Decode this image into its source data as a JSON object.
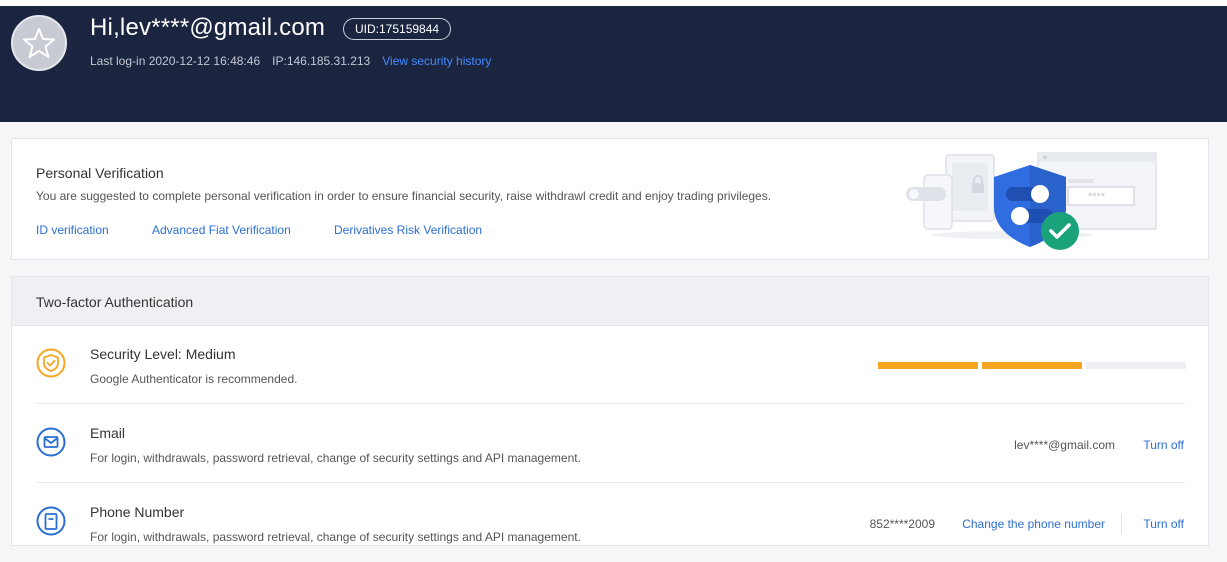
{
  "header": {
    "greeting": "Hi,lev****@gmail.com",
    "uid": "UID:175159844",
    "last_login": "Last log-in 2020-12-12 16:48:46",
    "ip": "IP:146.185.31.213",
    "security_history_link": "View security history",
    "avatar_icon": "star-icon"
  },
  "personal_verification": {
    "title": "Personal Verification",
    "description": "You are suggested to complete personal verification in order to ensure financial security, raise withdrawl credit and enjoy trading privileges.",
    "links": [
      "ID verification",
      "Advanced Fiat Verification",
      "Derivatives Risk Verification"
    ],
    "illustration_icon": "security-shield-illustration",
    "illustration_text": "****"
  },
  "two_factor": {
    "title": "Two-factor Authentication",
    "security_level": {
      "title": "Security Level: Medium",
      "description": "Google Authenticator is recommended.",
      "icon": "shield-icon",
      "segments_filled": 2,
      "segments_total": 3,
      "color": "#f5a623"
    },
    "email": {
      "title": "Email",
      "description": "For login, withdrawals, password retrieval, change of security settings and API management.",
      "value": "lev****@gmail.com",
      "action": "Turn off",
      "icon": "mail-icon"
    },
    "phone": {
      "title": "Phone Number",
      "description": "For login, withdrawals, password retrieval, change of security settings and API management.",
      "value": "852****2009",
      "change_action": "Change the phone number",
      "action": "Turn off",
      "icon": "phone-icon"
    }
  },
  "colors": {
    "header_bg": "#1b2540",
    "link": "#2d6fd1",
    "accent_warning": "#f5a623",
    "shield_blue": "#2f6de1",
    "check_green": "#1aa37a"
  }
}
